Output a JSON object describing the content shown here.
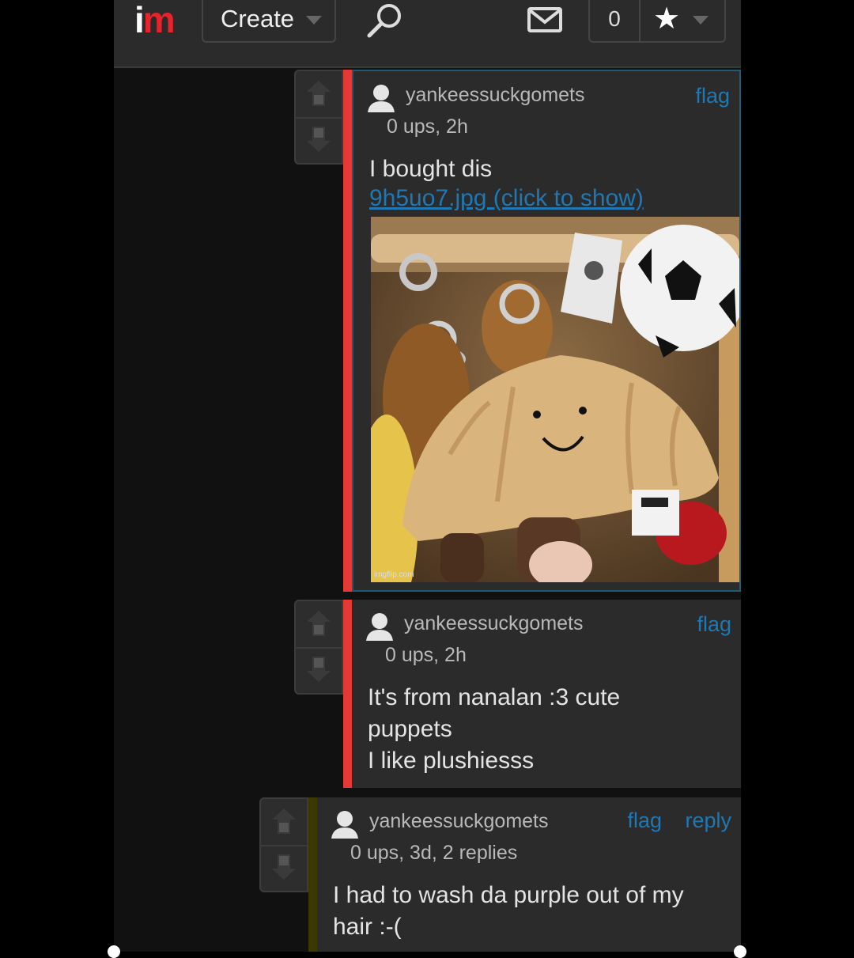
{
  "header": {
    "logo": {
      "i": "i",
      "m": "m"
    },
    "create_label": "Create",
    "notification_count": "0",
    "icons": [
      "search-icon",
      "mail-icon",
      "star-icon",
      "chevron-down-icon"
    ]
  },
  "comments": [
    {
      "username": "yankeessuckgomets",
      "meta": "0 ups, 2h",
      "flag": "flag",
      "text": "I bought dis",
      "image_link": "9h5uo7.jpg (click to show)",
      "image_watermark": "imgflip.com"
    },
    {
      "username": "yankeessuckgomets",
      "meta": "0 ups, 2h",
      "flag": "flag",
      "text_lines": [
        "It's from nanalan :3 cute",
        "puppets",
        "I like plushiesss"
      ]
    },
    {
      "username": "yankeessuckgomets",
      "meta": "0 ups, 3d, 2 replies",
      "flag": "flag",
      "reply": "reply",
      "text_lines": [
        "I had to wash da purple out of my",
        "hair :-("
      ]
    }
  ],
  "colors": {
    "accent_red": "#e8232b",
    "thread_bar_red": "#e53935",
    "thread_bar_olive": "#3a3a00",
    "link_blue": "#1f78b4",
    "highlight_border": "#1d5c73"
  }
}
